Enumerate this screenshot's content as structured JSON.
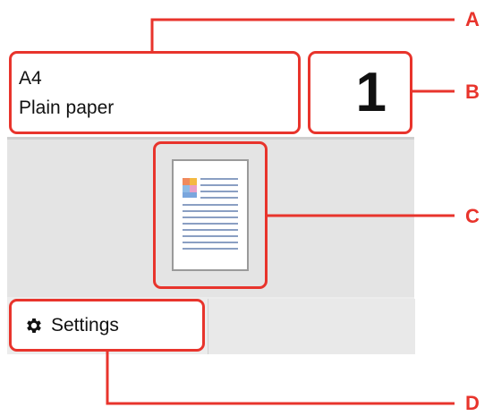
{
  "paper": {
    "size": "A4",
    "type": "Plain paper"
  },
  "copies": {
    "value": "1"
  },
  "preview": {
    "icon": "document-preview-icon"
  },
  "settings": {
    "label": "Settings",
    "icon": "gear-icon"
  },
  "callouts": {
    "a": "A",
    "b": "B",
    "c": "C",
    "d": "D"
  },
  "colors": {
    "highlight": "#e8342c",
    "screen_bg": "#e4e4e4"
  }
}
